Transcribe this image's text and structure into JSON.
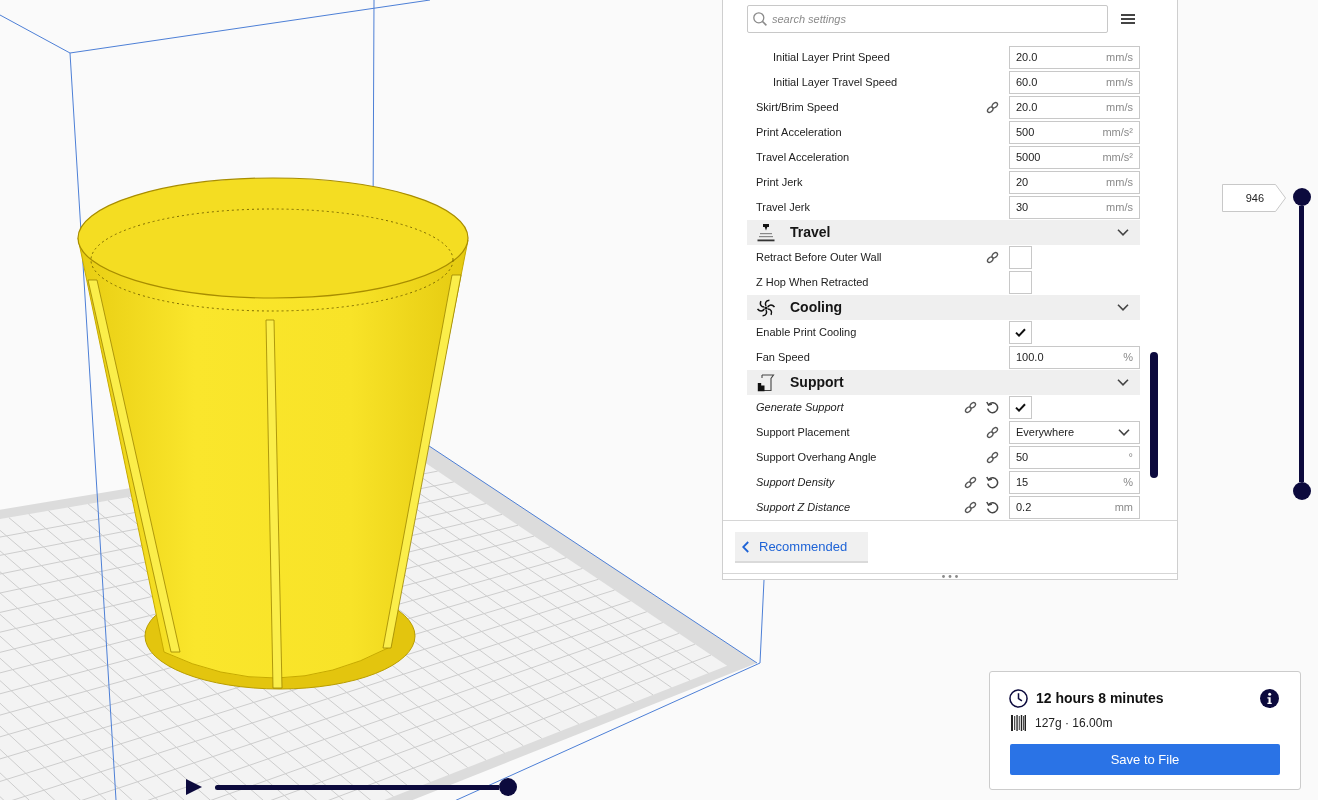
{
  "settings": {
    "search": {
      "placeholder": "search settings"
    },
    "rows": [
      {
        "kind": "group",
        "children": [
          {
            "kind": "number",
            "label": "Initial Layer Print Speed",
            "value": "20.0",
            "unit": "mm/s",
            "linked": false,
            "modified": false
          },
          {
            "kind": "number",
            "label": "Initial Layer Travel Speed",
            "value": "60.0",
            "unit": "mm/s",
            "linked": false,
            "modified": false
          }
        ]
      },
      {
        "kind": "number",
        "label": "Skirt/Brim Speed",
        "value": "20.0",
        "unit": "mm/s",
        "linked": true,
        "modified": false
      },
      {
        "kind": "number",
        "label": "Print Acceleration",
        "value": "500",
        "unit": "mm/s²",
        "linked": false,
        "modified": false
      },
      {
        "kind": "number",
        "label": "Travel Acceleration",
        "value": "5000",
        "unit": "mm/s²",
        "linked": false,
        "modified": false
      },
      {
        "kind": "number",
        "label": "Print Jerk",
        "value": "20",
        "unit": "mm/s",
        "linked": false,
        "modified": false
      },
      {
        "kind": "number",
        "label": "Travel Jerk",
        "value": "30",
        "unit": "mm/s",
        "linked": false,
        "modified": false
      }
    ],
    "categories": [
      {
        "title": "Travel",
        "expanded": true,
        "rows": [
          {
            "kind": "checkbox",
            "label": "Retract Before Outer Wall",
            "checked": false,
            "linked": true,
            "modified": false
          },
          {
            "kind": "checkbox",
            "label": "Z Hop When Retracted",
            "checked": false,
            "linked": false,
            "modified": false
          }
        ]
      },
      {
        "title": "Cooling",
        "expanded": true,
        "rows": [
          {
            "kind": "checkbox",
            "label": "Enable Print Cooling",
            "checked": true,
            "linked": false,
            "modified": false
          },
          {
            "kind": "number",
            "label": "Fan Speed",
            "value": "100.0",
            "unit": "%",
            "linked": false,
            "modified": false
          }
        ]
      },
      {
        "title": "Support",
        "expanded": true,
        "rows": [
          {
            "kind": "checkbox",
            "label": "Generate Support",
            "checked": true,
            "linked": true,
            "modified": true
          },
          {
            "kind": "dropdown",
            "label": "Support Placement",
            "value": "Everywhere",
            "linked": true,
            "modified": false
          },
          {
            "kind": "number",
            "label": "Support Overhang Angle",
            "value": "50",
            "unit": "°",
            "linked": true,
            "modified": false
          },
          {
            "kind": "number",
            "label": "Support Density",
            "value": "15",
            "unit": "%",
            "linked": true,
            "modified": true
          },
          {
            "kind": "number",
            "label": "Support Z Distance",
            "value": "0.2",
            "unit": "mm",
            "linked": true,
            "modified": true
          }
        ]
      }
    ]
  },
  "mode_button": {
    "label": "Recommended"
  },
  "layer_slider": {
    "upper": {
      "reading": "946",
      "level": 1
    },
    "lower": {
      "level": 0
    }
  },
  "playback": {
    "level": 1
  },
  "print_summary": {
    "time": "12 hours 8 minutes",
    "material": "127g · 16.00m",
    "save_button": "Save to File"
  }
}
